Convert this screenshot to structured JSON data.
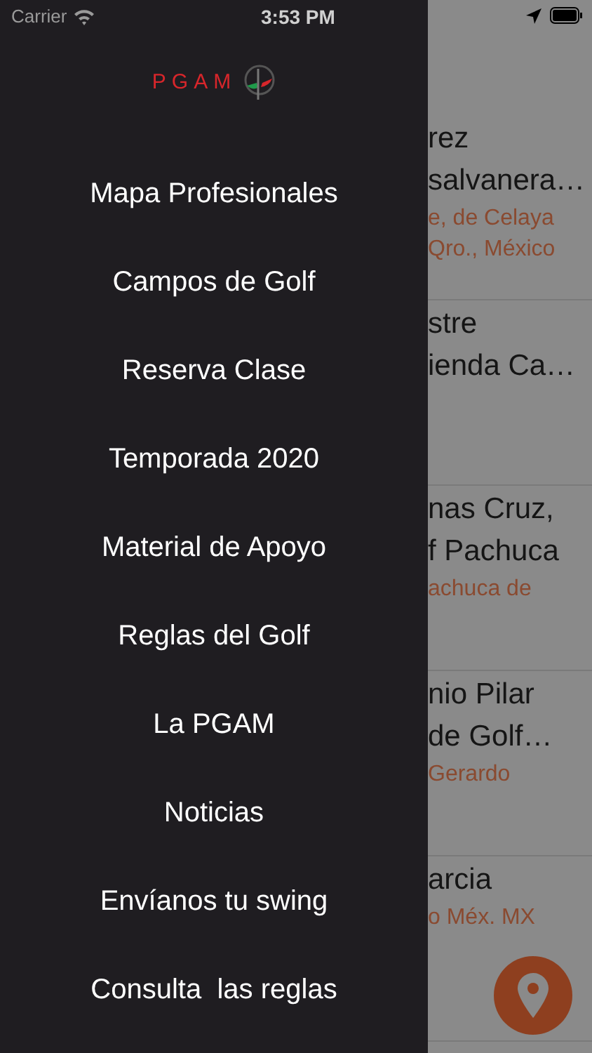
{
  "status_bar": {
    "carrier": "Carrier",
    "time": "3:53 PM"
  },
  "drawer": {
    "logo": "PGAM",
    "items": [
      {
        "label": "Mapa Profesionales"
      },
      {
        "label": "Campos de Golf"
      },
      {
        "label": "Reserva Clase"
      },
      {
        "label": "Temporada 2020"
      },
      {
        "label": "Material de Apoyo"
      },
      {
        "label": "Reglas del Golf"
      },
      {
        "label": "La PGAM"
      },
      {
        "label": "Noticias"
      },
      {
        "label": "Envíanos tu swing"
      },
      {
        "label": "Consulta  las reglas"
      }
    ]
  },
  "list": [
    {
      "title": [
        "rez",
        "salvanera…"
      ],
      "subtitle": [
        "e, de Celaya",
        "Qro., México"
      ]
    },
    {
      "title": [
        "stre",
        "ienda Ca…"
      ]
    },
    {
      "title": [
        "nas Cruz,",
        "f Pachuca"
      ],
      "subtitle": [
        "achuca de"
      ]
    },
    {
      "title": [
        "nio Pilar",
        "de Golf…"
      ],
      "subtitle": [
        "Gerardo"
      ]
    },
    {
      "title": [
        "arcia"
      ],
      "subtitle": [
        "o Méx. MX"
      ]
    }
  ]
}
